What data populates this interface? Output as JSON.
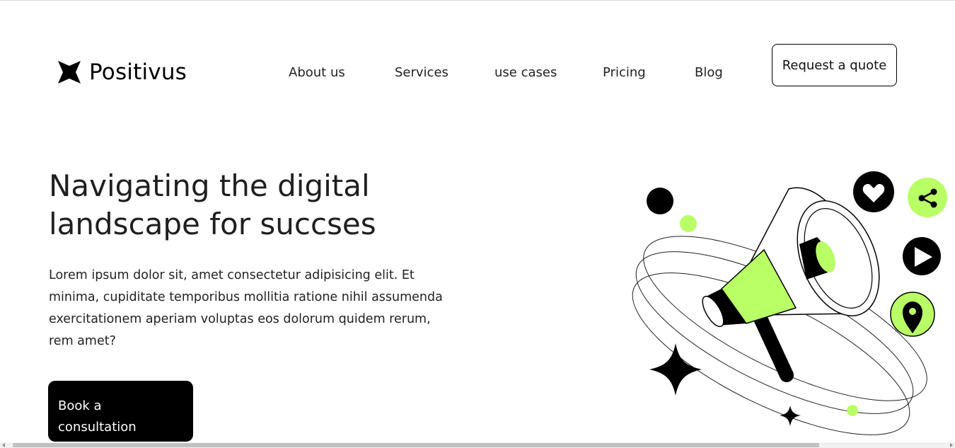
{
  "brand": {
    "name": "Positivus",
    "logo_icon": "four-point-star-icon"
  },
  "nav": {
    "items": [
      {
        "label": "About us"
      },
      {
        "label": "Services"
      },
      {
        "label": "use cases"
      },
      {
        "label": "Pricing"
      },
      {
        "label": "Blog"
      }
    ],
    "cta_label": "Request a quote"
  },
  "hero": {
    "title_line1": "Navigating the digital",
    "title_line2": "landscape for succses",
    "description": "Lorem ipsum dolor sit, amet consectetur adipisicing elit. Et minima, cupiditate temporibus mollitia ratione nihil assumenda exercitationem aperiam voluptas eos dolorum quidem rerum, rem amet?",
    "cta_line1": "Book a",
    "cta_line2": "consultation"
  },
  "illustration": {
    "icons": [
      "megaphone-icon",
      "heart-icon",
      "share-icon",
      "play-icon",
      "location-pin-icon",
      "sparkle-icon"
    ]
  },
  "colors": {
    "accent": "#B9FF66",
    "dark": "#000000",
    "text": "#222222",
    "background": "#FFFFFF"
  }
}
